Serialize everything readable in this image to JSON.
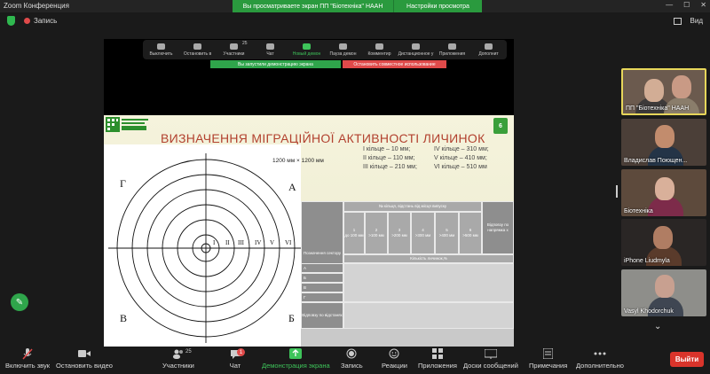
{
  "app": {
    "title": "Zoom Конференция"
  },
  "banner": {
    "viewing": "Вы просматриваете экран ПП \"Біотехніка\" НААН",
    "options": "Настройки просмотра"
  },
  "top": {
    "recording": "Запись",
    "view": "Вид"
  },
  "share_toolbar": {
    "items": [
      "Выключить",
      "Остановить в",
      "Участники",
      "Чат",
      "Новый демон",
      "Пауза демон",
      "Комментир",
      "Дистанционное у",
      "Приложения",
      "Дополнит"
    ],
    "participants_count": "25"
  },
  "notices": {
    "green": "Вы запустили демонстрацию экрана",
    "red": "Остановить совместное использование"
  },
  "slide": {
    "number": "6",
    "title": "ВИЗНАЧЕННЯ МІГРАЦІЙНОЇ АКТИВНОСТІ ЛИЧИНОК",
    "dimensions": "1200 мм × 1200 мм",
    "quadrants": {
      "tl": "Г",
      "tr": "А",
      "bl": "В",
      "br": "Б"
    },
    "ring_labels": [
      "I",
      "II",
      "III",
      "IV",
      "V",
      "VI"
    ],
    "rings_left": [
      "І кільце – 10 мм;",
      "ІІ кільце – 110 мм;",
      "ІІІ кільце – 210 мм;"
    ],
    "rings_right": [
      "IV кільце – 310 мм;",
      "V кільце – 410 мм;",
      "VI кільце – 510 мм"
    ],
    "table": {
      "col0": "Позначення сектору",
      "group": "№ кільця, відстань від місця випуску",
      "ring_cols": [
        {
          "num": "1",
          "range": "до 100 мм"
        },
        {
          "num": "2",
          "range": ">100 мм"
        },
        {
          "num": "3",
          "range": ">200 мм"
        },
        {
          "num": "4",
          "range": ">300 мм"
        },
        {
          "num": "5",
          "range": ">400 мм"
        },
        {
          "num": "6",
          "range": ">500 мм"
        }
      ],
      "last_col": "Відповзу по напрямка х",
      "unit_row": "Кількість личинок,%",
      "rows": [
        "А",
        "Б",
        "В",
        "Г"
      ],
      "footer": "Відповзу по відстанях"
    }
  },
  "participants": [
    {
      "name": "ПП \"Біотехніка\" НААН"
    },
    {
      "name": "Владислав Поющен..."
    },
    {
      "name": "Біотехніка"
    },
    {
      "name": "iPhone Liudmyla"
    },
    {
      "name": "Vasyl Khodorchuk"
    }
  ],
  "bottom": {
    "mute": "Включить звук",
    "video": "Остановить видео",
    "participants": "Участники",
    "participants_count": "25",
    "chat": "Чат",
    "chat_badge": "1",
    "share": "Демонстрация экрана",
    "record": "Запись",
    "reactions": "Реакции",
    "apps": "Приложения",
    "whiteboards": "Доски сообщений",
    "notes": "Примечания",
    "more": "Дополнительно",
    "leave": "Выйти"
  },
  "colors": {
    "accent_green": "#2a9a3e",
    "leave_red": "#d9342b",
    "slide_title": "#b2412f"
  }
}
